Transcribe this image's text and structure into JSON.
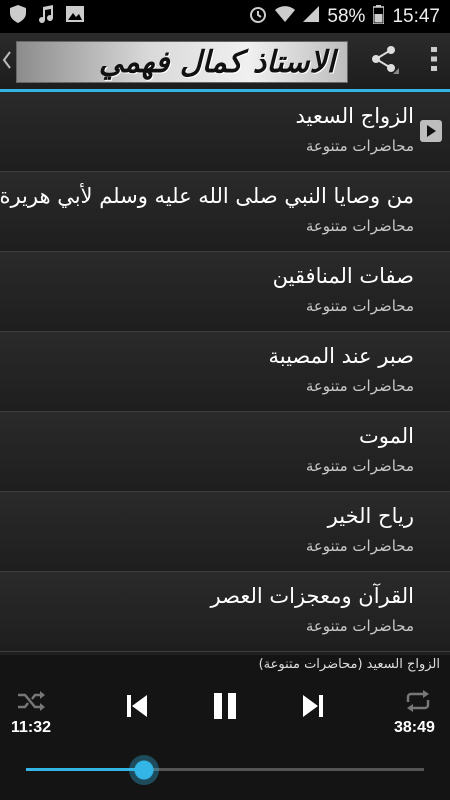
{
  "status_bar": {
    "battery_percent": "58%",
    "time": "15:47",
    "icons": [
      "shield-icon",
      "music-note-icon",
      "image-icon",
      "alarm-icon",
      "wifi-icon",
      "signal-icon",
      "battery-icon"
    ]
  },
  "action_bar": {
    "title": "الاستاذ  كمال فهمي",
    "icons": [
      "back-arrow-icon",
      "share-icon",
      "overflow-menu-icon"
    ],
    "accent": "#33b5e5"
  },
  "list": {
    "items": [
      {
        "title": "الزواج السعيد",
        "subtitle": "محاضرات متنوعة",
        "playing": true
      },
      {
        "title": "من وصايا النبي صلى الله عليه وسلم لأبي هريرة",
        "subtitle": "محاضرات متنوعة"
      },
      {
        "title": "صفات المنافقين",
        "subtitle": "محاضرات متنوعة"
      },
      {
        "title": "صبر عند المصيبة",
        "subtitle": "محاضرات متنوعة"
      },
      {
        "title": "الموت",
        "subtitle": "محاضرات متنوعة"
      },
      {
        "title": "رياح الخير",
        "subtitle": "محاضرات متنوعة"
      },
      {
        "title": "القرآن ومعجزات العصر",
        "subtitle": "محاضرات متنوعة"
      }
    ]
  },
  "player": {
    "now_playing": "الزواج السعيد (محاضرات متنوعة)",
    "elapsed": "11:32",
    "duration": "38:49",
    "progress_fraction": 0.297,
    "controls": [
      "shuffle-icon",
      "previous-icon",
      "pause-icon",
      "next-icon",
      "repeat-icon"
    ]
  }
}
